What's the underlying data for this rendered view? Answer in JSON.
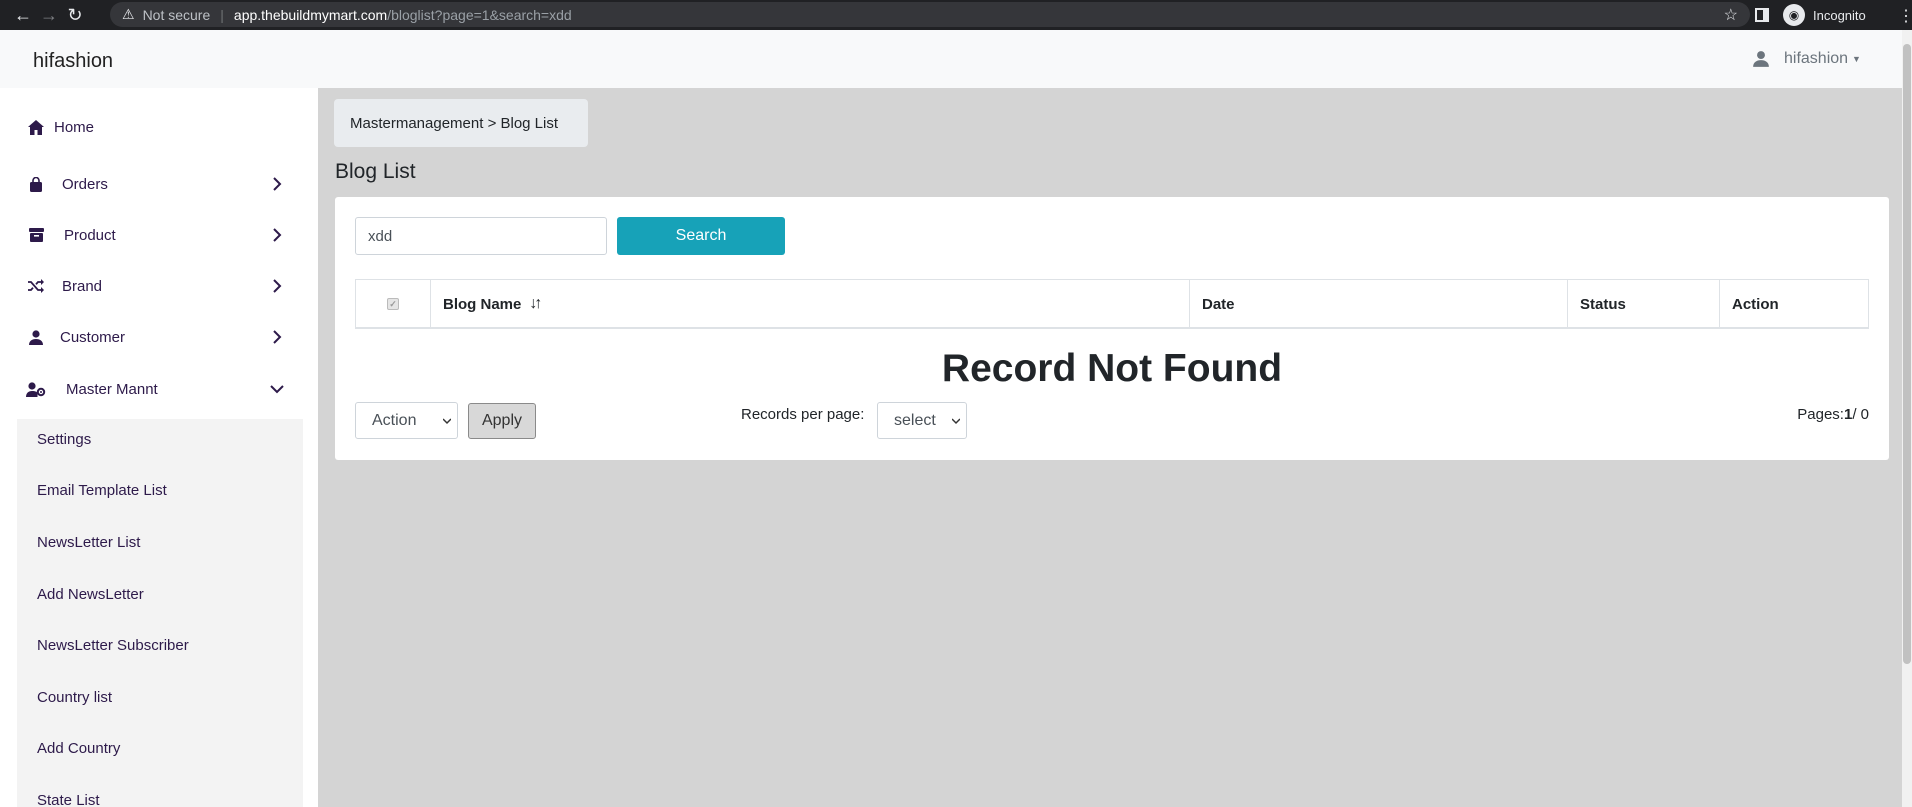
{
  "browser": {
    "security_label": "Not secure",
    "url_host": "app.thebuildmymart.com",
    "url_path": "/bloglist?page=1&search=xdd",
    "incognito_label": "Incognito"
  },
  "header": {
    "brand": "hifashion",
    "user_name": "hifashion"
  },
  "sidebar": {
    "items": [
      {
        "label": "Home"
      },
      {
        "label": "Orders"
      },
      {
        "label": "Product"
      },
      {
        "label": "Brand"
      },
      {
        "label": "Customer"
      },
      {
        "label": "Master Mannt"
      }
    ],
    "submenu": [
      {
        "label": "Settings"
      },
      {
        "label": "Email Template List"
      },
      {
        "label": "NewsLetter List"
      },
      {
        "label": "Add NewsLetter"
      },
      {
        "label": "NewsLetter Subscriber"
      },
      {
        "label": "Country list"
      },
      {
        "label": "Add Country"
      },
      {
        "label": "State List"
      }
    ]
  },
  "breadcrumb": "Mastermanagement > Blog List",
  "page_title": "Blog List",
  "search": {
    "value": "xdd",
    "button_label": "Search"
  },
  "table": {
    "columns": [
      "Blog Name",
      "Date",
      "Status",
      "Action"
    ],
    "sort_glyph": "↓↑",
    "empty_message": "Record Not Found"
  },
  "bulk": {
    "action_selected": "Action",
    "apply_label": "Apply"
  },
  "pagination": {
    "records_per_page_label": "Records per page:",
    "records_per_page_selected": "select",
    "pages_label": "Pages:",
    "current_page": "1",
    "total_pages": "/ 0"
  },
  "colors": {
    "accent": "#17a2b8",
    "sidebar_text": "#2d1a4a",
    "content_bg": "#d4d4d4"
  }
}
